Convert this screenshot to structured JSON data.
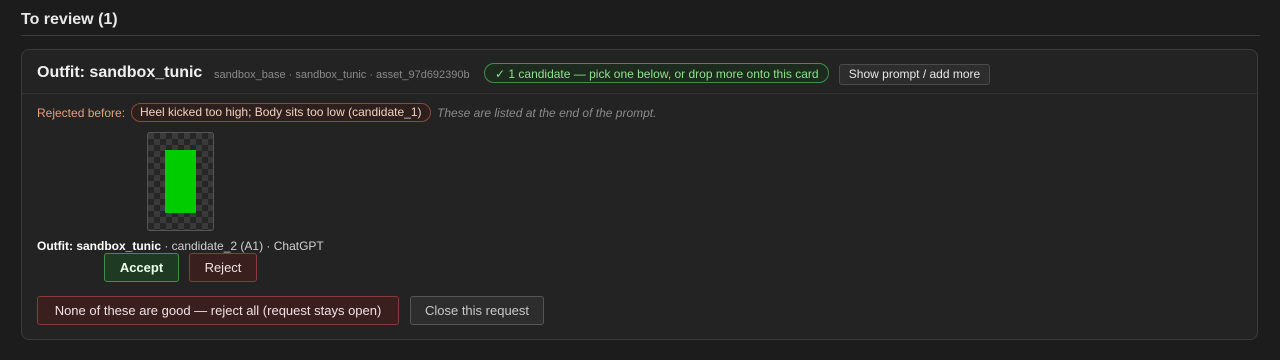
{
  "section": {
    "title": "To review (1)"
  },
  "card": {
    "title": "Outfit: sandbox_tunic",
    "meta": "sandbox_base · sandbox_tunic · asset_97d692390b",
    "candidate_pill": "✓ 1 candidate — pick one below, or drop more onto this card",
    "show_prompt_label": "Show prompt / add more",
    "rejected_label": "Rejected before:",
    "rejected_reason": "Heel kicked too high; Body sits too low (candidate_1)",
    "rejected_note": "These are listed at the end of the prompt.",
    "candidate": {
      "name": "Outfit: sandbox_tunic",
      "detail": " · candidate_2 (A1) · ChatGPT",
      "accept_label": "Accept",
      "reject_label": "Reject",
      "sprite_color": "#00cc00"
    },
    "reject_all_label": "None of these are good — reject all (request stays open)",
    "close_label": "Close this request"
  },
  "colors": {
    "background": "#1c1c1c",
    "accept_border": "#3f8f4a",
    "reject_border": "#8a3a3a",
    "success_text": "#8fe08f",
    "warning_text": "#e6a07a"
  }
}
